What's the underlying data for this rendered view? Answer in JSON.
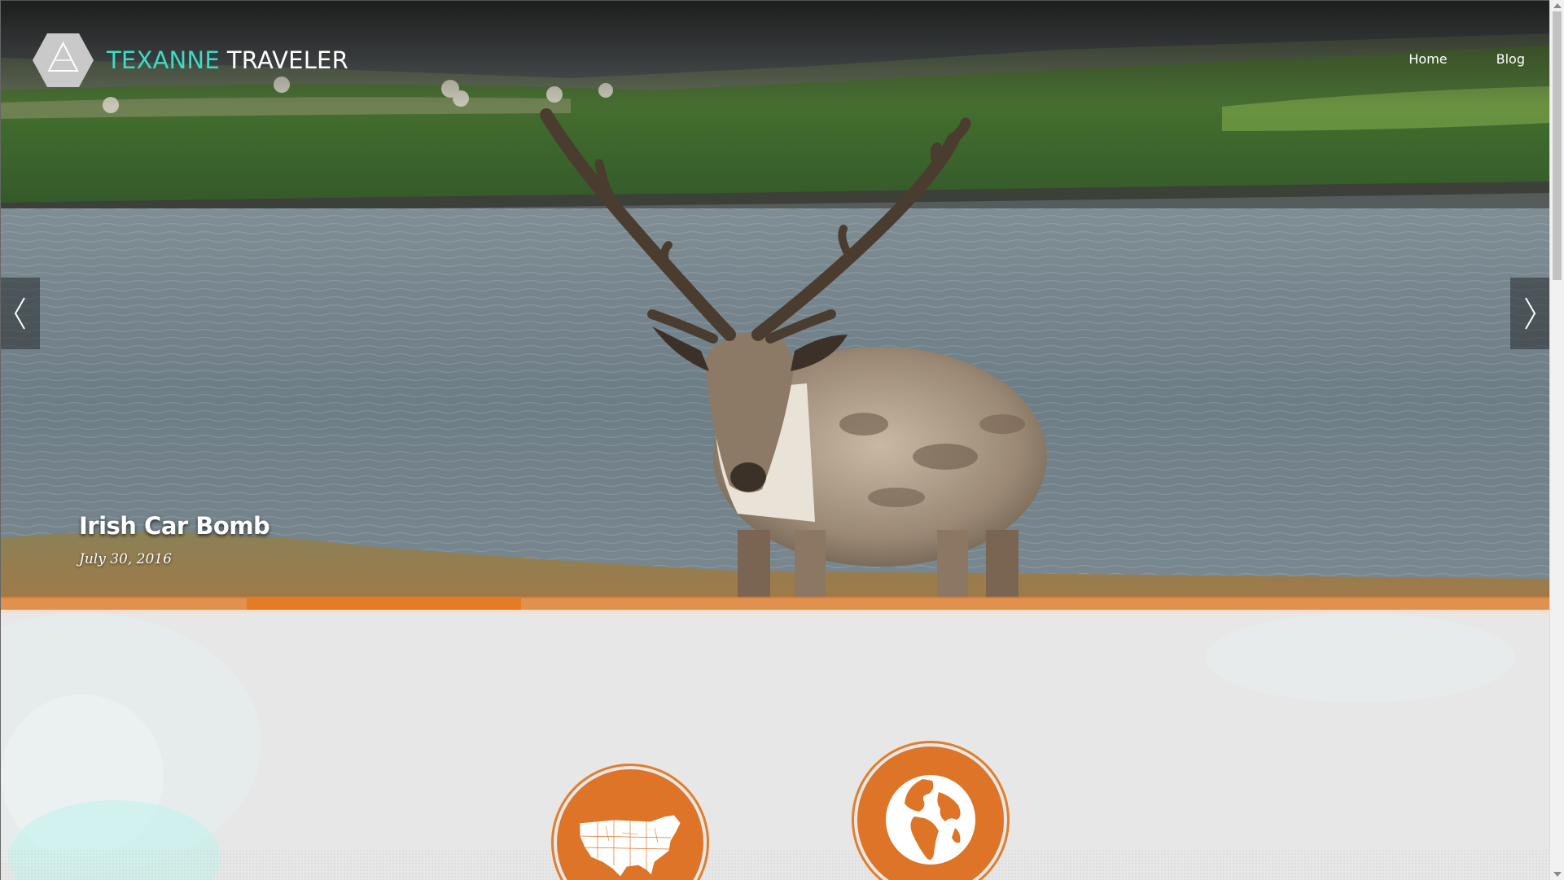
{
  "site": {
    "brand_accent": "TEXANNE",
    "brand_main": "TRAVELER",
    "accent_color": "#3ddbc4",
    "logo_icon": "triangle-hexagon-logo"
  },
  "nav": {
    "items": [
      {
        "label": "Home"
      },
      {
        "label": "Blog"
      }
    ]
  },
  "slider": {
    "title": "Irish Car Bomb",
    "date": "July 30, 2016",
    "prev_icon": "chevron-left-icon",
    "next_icon": "chevron-right-icon",
    "progress_color": "#e57b25"
  },
  "features": [
    {
      "icon": "usa-map-icon"
    },
    {
      "icon": "globe-icon"
    }
  ]
}
